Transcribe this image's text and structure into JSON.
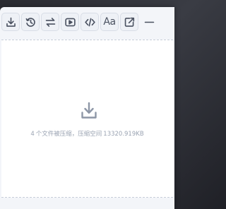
{
  "toolbar": {
    "buttons": [
      {
        "icon": "download-icon"
      },
      {
        "icon": "history-icon"
      },
      {
        "icon": "swap-icon"
      },
      {
        "icon": "play-icon"
      },
      {
        "icon": "code-icon"
      },
      {
        "icon": "font-icon",
        "label": "Aa"
      },
      {
        "icon": "export-icon"
      },
      {
        "icon": "minimize-icon"
      }
    ]
  },
  "dropzone": {
    "icon": "download-icon",
    "status_count": "4",
    "status_text": "个文件被压缩，压缩空间",
    "status_size": "13320.919KB"
  },
  "colors": {
    "panel": "#f3f5f9",
    "icon": "#4a5160",
    "muted": "#9aa3b2"
  }
}
